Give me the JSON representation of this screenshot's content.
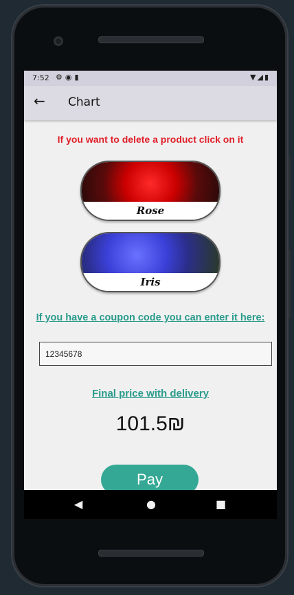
{
  "status_bar": {
    "time": "7:52"
  },
  "app_bar": {
    "title": "Chart"
  },
  "screen": {
    "delete_hint": "If you want to delete a product click on it",
    "products": [
      {
        "name": "Rose"
      },
      {
        "name": "Iris"
      }
    ],
    "coupon_hint": "If you have a coupon code you can enter it here:",
    "coupon_value": "12345678",
    "final_label": "Final price with delivery",
    "final_price": "101.5₪",
    "pay_label": "Pay"
  },
  "colors": {
    "accent_teal": "#35a895",
    "warning_red": "#e0202a",
    "appbar_bg": "#dcdae2"
  },
  "icons": {
    "back": "arrow-back-icon",
    "status_left": [
      "gear-icon",
      "android-icon",
      "sim-card-icon"
    ],
    "status_right": [
      "wifi-icon",
      "signal-icon",
      "battery-icon"
    ],
    "nav": [
      "back-triangle-icon",
      "home-circle-icon",
      "recents-square-icon"
    ]
  }
}
